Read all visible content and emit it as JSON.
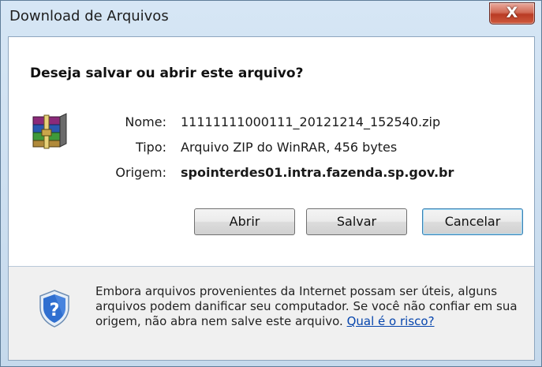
{
  "window": {
    "title": "Download de Arquivos",
    "close_label": "X"
  },
  "dialog": {
    "question": "Deseja salvar ou abrir este arquivo?",
    "file_icon": "winrar-archive-icon",
    "fields": {
      "name_label": "Nome:",
      "name_value": "11111111000111_20121214_152540.zip",
      "type_label": "Tipo:",
      "type_value": "Arquivo ZIP do WinRAR, 456 bytes",
      "origin_label": "Origem:",
      "origin_value": "spointerdes01.intra.fazenda.sp.gov.br"
    },
    "buttons": {
      "open": "Abrir",
      "save": "Salvar",
      "cancel": "Cancelar"
    }
  },
  "footer": {
    "icon": "security-shield-question-icon",
    "warning_text": "Embora arquivos provenientes da Internet possam ser úteis, alguns arquivos podem danificar seu computador. Se você não confiar em sua origem, não abra nem salve este arquivo. ",
    "risk_link": "Qual é o risco?"
  }
}
